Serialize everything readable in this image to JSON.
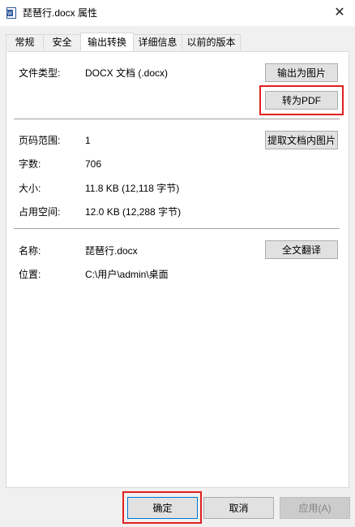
{
  "window": {
    "title": "琵琶行.docx 属性",
    "icon": "word-document-icon",
    "close_glyph": "✕"
  },
  "tabs": [
    {
      "label": "常规",
      "active": false
    },
    {
      "label": "安全",
      "active": false
    },
    {
      "label": "输出转换",
      "active": true
    },
    {
      "label": "详细信息",
      "active": false
    },
    {
      "label": "以前的版本",
      "active": false
    }
  ],
  "section1": {
    "file_type_label": "文件类型:",
    "file_type_value": "DOCX 文档 (.docx)",
    "export_image_button": "输出为图片",
    "to_pdf_button": "转为PDF"
  },
  "section2": {
    "page_range_label": "页码范围:",
    "page_range_value": "1",
    "word_count_label": "字数:",
    "word_count_value": "706",
    "size_label": "大小:",
    "size_value": "11.8 KB (12,118 字节)",
    "disk_size_label": "占用空间:",
    "disk_size_value": "12.0 KB (12,288 字节)",
    "extract_images_button": "提取文档内图片"
  },
  "section3": {
    "name_label": "名称:",
    "name_value": "琵琶行.docx",
    "location_label": "位置:",
    "location_value": "C:\\用户\\admin\\桌面",
    "translate_button": "全文翻译"
  },
  "footer": {
    "ok_button": "确定",
    "cancel_button": "取消",
    "apply_button": "应用(A)"
  },
  "colors": {
    "highlight": "#e0201f",
    "default_button_border": "#0078d7"
  }
}
